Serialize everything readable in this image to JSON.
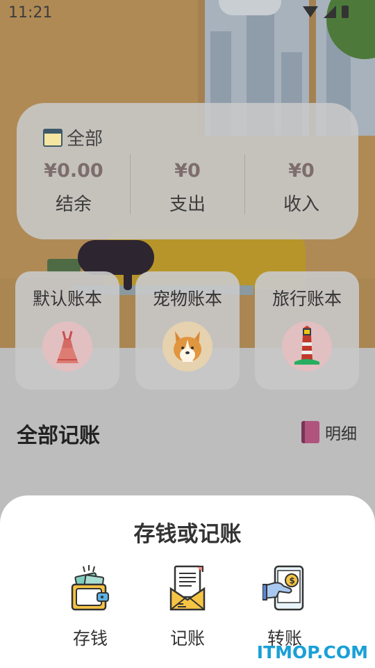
{
  "status_bar": {
    "time": "11:21"
  },
  "summary": {
    "title": "全部",
    "stats": [
      {
        "value": "¥0.00",
        "label": "结余"
      },
      {
        "value": "¥0",
        "label": "支出"
      },
      {
        "value": "¥0",
        "label": "收入"
      }
    ]
  },
  "books": [
    {
      "name": "默认账本",
      "icon": "dress-icon"
    },
    {
      "name": "宠物账本",
      "icon": "dog-icon"
    },
    {
      "name": "旅行账本",
      "icon": "lighthouse-icon"
    }
  ],
  "records": {
    "title": "全部记账",
    "detail_label": "明细"
  },
  "sheet": {
    "title": "存钱或记账",
    "actions": [
      {
        "label": "存钱",
        "icon": "wallet-icon"
      },
      {
        "label": "记账",
        "icon": "bill-icon"
      },
      {
        "label": "转账",
        "icon": "transfer-phone-icon"
      }
    ]
  },
  "watermark": "ITMOP.COM",
  "colors": {
    "accent": "#7d6d6d",
    "sheet_bg": "#ffffff",
    "watermark": "#1aa0d6"
  }
}
